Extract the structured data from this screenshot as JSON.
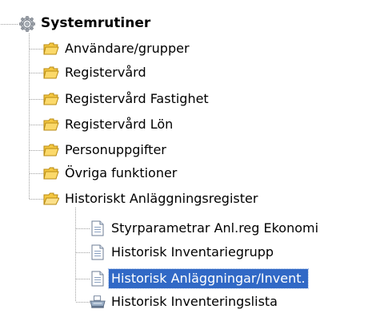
{
  "tree": {
    "root": {
      "label": "Systemrutiner",
      "icon": "gear-icon"
    },
    "items": [
      {
        "label": "Användare/grupper",
        "icon": "folder-icon"
      },
      {
        "label": "Registervård",
        "icon": "folder-icon"
      },
      {
        "label": "Registervård Fastighet",
        "icon": "folder-icon"
      },
      {
        "label": "Registervård Lön",
        "icon": "folder-icon"
      },
      {
        "label": "Personuppgifter",
        "icon": "folder-icon"
      },
      {
        "label": "Övriga funktioner",
        "icon": "folder-icon"
      },
      {
        "label": "Historiskt Anläggningsregister",
        "icon": "folder-open-icon",
        "children": [
          {
            "label": "Styrparametrar Anl.reg Ekonomi",
            "icon": "document-icon"
          },
          {
            "label": "Historisk Inventariegrupp",
            "icon": "document-icon"
          },
          {
            "label": "Historisk Anläggningar/Invent.",
            "icon": "document-icon",
            "selected": true
          },
          {
            "label": "Historisk Inventeringslista",
            "icon": "printer-icon"
          }
        ]
      }
    ]
  },
  "colors": {
    "selection": "#3169c6",
    "folder": "#f5c842",
    "tree_line": "#a0a0a0"
  }
}
